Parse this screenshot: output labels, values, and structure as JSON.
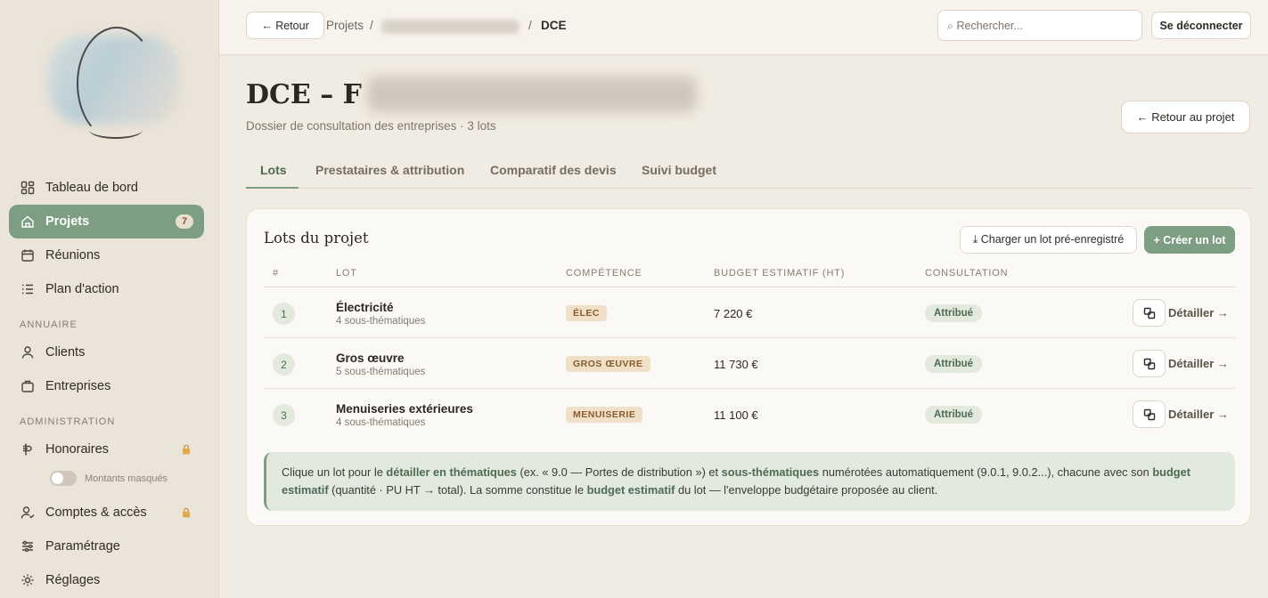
{
  "sidebar": {
    "items": [
      {
        "label": "Tableau de bord",
        "icon": "dashboard-icon"
      },
      {
        "label": "Projets",
        "icon": "home-icon",
        "badge": "7",
        "active": true
      },
      {
        "label": "Réunions",
        "icon": "calendar-icon"
      },
      {
        "label": "Plan d'action",
        "icon": "list-icon"
      }
    ],
    "section_annuaire": "ANNUAIRE",
    "annuaire_items": [
      {
        "label": "Clients",
        "icon": "user-icon"
      },
      {
        "label": "Entreprises",
        "icon": "briefcase-icon"
      }
    ],
    "section_admin": "ADMINISTRATION",
    "admin_items": [
      {
        "label": "Honoraires",
        "icon": "currency-icon",
        "locked": true
      },
      {
        "label": "Comptes & accès",
        "icon": "user-check-icon",
        "locked": true
      },
      {
        "label": "Paramétrage",
        "icon": "sliders-icon"
      },
      {
        "label": "Réglages",
        "icon": "sun-icon"
      }
    ],
    "toggle_label": "Montants masqués"
  },
  "topbar": {
    "back_label": "← Retour",
    "breadcrumb_projects": "Projets",
    "breadcrumb_sep": "/",
    "breadcrumb_current": "DCE",
    "search_placeholder": "⌕ Rechercher...",
    "logout_label": "Se déconnecter"
  },
  "page": {
    "title_prefix": "DCE – F",
    "subtitle": "Dossier de consultation des entreprises · 3 lots",
    "back_project_label": "← Retour au projet"
  },
  "tabs": [
    "Lots",
    "Prestataires & attribution",
    "Comparatif des devis",
    "Suivi budget"
  ],
  "card": {
    "title": "Lots du projet",
    "load_label": "⤓ Charger un lot pré-enregistré",
    "create_label": "+ Créer un lot",
    "headers": [
      "#",
      "LOT",
      "COMPÉTENCE",
      "BUDGET ESTIMATIF (HT)",
      "CONSULTATION"
    ],
    "rows": [
      {
        "num": "1",
        "name": "Électricité",
        "sub": "4 sous-thématiques",
        "comp": "ÉLEC",
        "budget": "7 220 €",
        "status": "Attribué",
        "action": "Détailler →"
      },
      {
        "num": "2",
        "name": "Gros œuvre",
        "sub": "5 sous-thématiques",
        "comp": "GROS ŒUVRE",
        "budget": "11 730 €",
        "status": "Attribué",
        "action": "Détailler →"
      },
      {
        "num": "3",
        "name": "Menuiseries extérieures",
        "sub": "4 sous-thématiques",
        "comp": "MENUISERIE",
        "budget": "11 100 €",
        "status": "Attribué",
        "action": "Détailler →"
      }
    ],
    "info": {
      "p1": "Clique un lot pour le ",
      "b1": "détailler en thématiques",
      "p2": " (ex. « 9.0 — Portes de distribution ») et ",
      "b2": "sous-thématiques",
      "p3": " numérotées automatiquement (9.0.1, 9.0.2...), chacune avec son ",
      "b3": "budget estimatif",
      "p4": " (quantité · PU HT → total). La somme constitue le ",
      "b4": "budget estimatif",
      "p5": " du lot — l'enveloppe budgétaire proposée au client."
    }
  },
  "colors": {
    "accent": "#7e9e84",
    "background": "#f1ece3",
    "sidebar": "#ebe4d8"
  }
}
